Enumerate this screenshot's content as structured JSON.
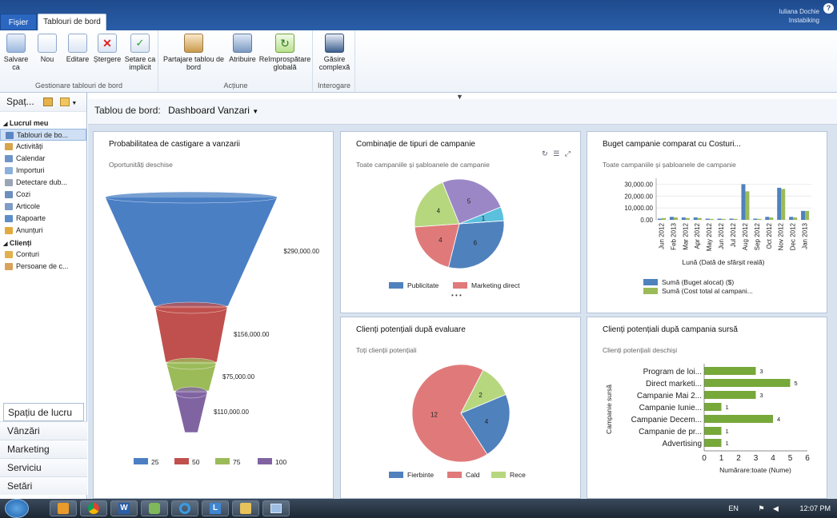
{
  "tabs": {
    "file": "Fișier",
    "board": "Tablouri de bord"
  },
  "user": {
    "name": "Iuliana Dochie",
    "org": "Instabiking"
  },
  "ribbon": {
    "groups": [
      {
        "label": "Gestionare tablouri de bord",
        "buttons": [
          "Salvare ca",
          "Nou",
          "Editare",
          "Ștergere",
          "Setare ca implicit"
        ]
      },
      {
        "label": "Acțiune",
        "buttons": [
          "Partajare tablou de bord",
          "Atribuire",
          "Reîmprospătare globală"
        ]
      },
      {
        "label": "Interogare",
        "buttons": [
          "Găsire complexă"
        ]
      }
    ]
  },
  "nav": {
    "title": "Spaț...",
    "sections": [
      {
        "title": "Lucrul meu",
        "items": [
          "Tablouri de bo...",
          "Activități",
          "Calendar",
          "Importuri",
          "Detectare dub...",
          "Cozi",
          "Articole",
          "Rapoarte",
          "Anunțuri"
        ]
      },
      {
        "title": "Clienți",
        "items": [
          "Conturi",
          "Persoane de c..."
        ]
      }
    ],
    "workspaces": [
      "Spațiu de lucru",
      "Vânzări",
      "Marketing",
      "Serviciu",
      "Setări"
    ]
  },
  "dashboard": {
    "label": "Tablou de bord:",
    "name": "Dashboard Vanzari"
  },
  "panels": {
    "funnel": {
      "title": "Probabilitatea de castigare a vanzarii",
      "subtitle": "Oportunități deschise"
    },
    "pie1": {
      "title": "Combinație de tipuri de campanie",
      "subtitle": "Toate campaniile și șabloanele de campanie",
      "more": "• • •"
    },
    "bars": {
      "title": "Buget campanie comparat cu Costuri...",
      "subtitle": "Toate campaniile și șabloanele de campanie"
    },
    "pie2": {
      "title": "Clienți potențiali după evaluare",
      "subtitle": "Toți clienții potențiali"
    },
    "hbar": {
      "title": "Clienți potențiali după campania sursă",
      "subtitle": "Clienți potențiali deschiși"
    }
  },
  "chart_data": [
    {
      "type": "funnel",
      "categories": [
        "25",
        "50",
        "75",
        "100"
      ],
      "values": [
        290000,
        156000,
        75000,
        110000
      ],
      "value_labels": [
        "$290,000.00",
        "$156,000.00",
        "$75,000.00",
        "$110,000.00"
      ],
      "colors": [
        "#4a7fc4",
        "#c0504d",
        "#9bbb59",
        "#8064a2"
      ]
    },
    {
      "type": "pie",
      "series": [
        {
          "name": "Publicitate",
          "values": [
            6,
            4,
            4,
            5,
            1
          ]
        }
      ],
      "slice_colors": [
        "#4f81bd",
        "#e07a7a",
        "#b6d77e",
        "#9c87c6",
        "#5bc0de"
      ],
      "legend": [
        "Publicitate",
        "Marketing direct"
      ],
      "legend_colors": [
        "#4f81bd",
        "#e07a7a"
      ]
    },
    {
      "type": "bar",
      "categories": [
        "Jun 2012",
        "Feb 2013",
        "Mar 2012",
        "Apr 2012",
        "May 2012",
        "Jun 2012",
        "Jul 2012",
        "Aug 2012",
        "Sep 2012",
        "Oct 2012",
        "Nov 2012",
        "Dec 2012",
        "Jan 2013"
      ],
      "series": [
        {
          "name": "Sumă (Buget alocat) ($)",
          "values": [
            1000,
            2500,
            2000,
            2000,
            1000,
            1000,
            1000,
            30000,
            1000,
            2500,
            27000,
            2500,
            7500
          ]
        },
        {
          "name": "Sumă (Cost total al campani...",
          "values": [
            1500,
            2000,
            1500,
            1500,
            800,
            800,
            800,
            24000,
            800,
            2000,
            26000,
            2000,
            7500
          ]
        }
      ],
      "yticks": [
        "30,000.00",
        "20,000.00",
        "10,000.00",
        "0.00"
      ],
      "ylim": [
        0,
        35000
      ],
      "xlabel": "Lună (Dată de sfârșit reală)",
      "colors": [
        "#4f81bd",
        "#9bbb59"
      ]
    },
    {
      "type": "pie",
      "series": [
        {
          "name": "Clienți potențiali",
          "values": [
            12,
            2,
            4
          ]
        }
      ],
      "slice_colors": [
        "#e07a7a",
        "#b6d77e",
        "#4f81bd"
      ],
      "legend": [
        "Fierbinte",
        "Cald",
        "Rece"
      ],
      "legend_colors": [
        "#4f81bd",
        "#e07a7a",
        "#b6d77e"
      ]
    },
    {
      "type": "bar",
      "orientation": "horizontal",
      "categories": [
        "Program de loi...",
        "Direct marketi...",
        "Campanie Mai 2...",
        "Campanie Iunie...",
        "Campanie Decem...",
        "Campanie de pr...",
        "Advertising"
      ],
      "values": [
        3,
        5,
        3,
        1,
        4,
        1,
        1
      ],
      "xlim": [
        0,
        6
      ],
      "xticks": [
        "0",
        "1",
        "2",
        "3",
        "4",
        "5",
        "6"
      ],
      "xlabel": "Numărare:toate (Nume)",
      "ylabel": "Campanie sursă",
      "color": "#77a83a"
    }
  ],
  "taskbar": {
    "lang": "EN",
    "time": "12:07 PM"
  }
}
